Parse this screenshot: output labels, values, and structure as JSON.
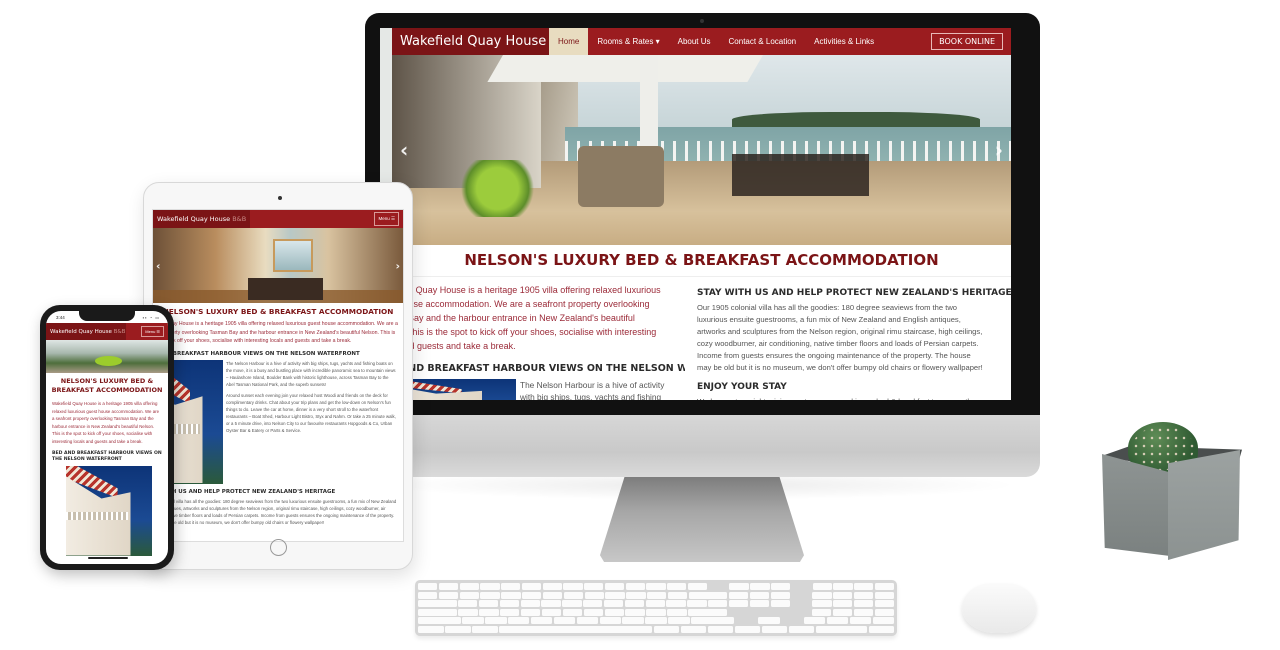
{
  "site": {
    "brand_name": "Wakefield Quay House",
    "brand_suffix": "B&B",
    "nav": [
      {
        "label": "Home",
        "active": true
      },
      {
        "label": "Rooms & Rates ▾",
        "active": false
      },
      {
        "label": "About Us",
        "active": false
      },
      {
        "label": "Contact & Location",
        "active": false
      },
      {
        "label": "Activities & Links",
        "active": false
      }
    ],
    "book_button": "BOOK ONLINE",
    "menu_button": "Menu ☰",
    "carousel_prev": "‹",
    "carousel_next": "›",
    "main_heading": "NELSON'S LUXURY BED & BREAKFAST ACCOMMODATION",
    "intro_lines": [
      "Wakefield Quay House is a heritage 1905 villa offering relaxed luxurious",
      "guest house accommodation. We are a seafront property overlooking",
      "Tasman Bay and the harbour entrance in New Zealand's beautiful",
      "Nelson. This is the spot to kick off your shoes, socialise with interesting",
      "locals and guests and take a break."
    ],
    "intro_full": "Wakefield Quay House is a heritage 1905 villa offering relaxed luxurious guest house accommodation. We are a seafront property overlooking Tasman Bay and the harbour entrance in New Zealand's beautiful Nelson. This is the spot to kick off your shoes, socialise with interesting locals and guests and take a break.",
    "harbour_heading": "BED AND BREAKFAST HARBOUR VIEWS ON THE NELSON WATERFRONT",
    "harbour_text": "The Nelson Harbour is a hive of activity with big ships, tugs, yachts and fishing boats on the move, it is a busy and bustling place with incredible panoramic sea to mountain views – Haulashore Island, Boulder Bank with historic lighthouse, across Tasman Bay to the Abel Tasman National Park, and the superb sunsets!",
    "sunset_text": "Around sunset each evening join your relaxed host Woodi and friends on the deck for complimentary drinks. Chat about your trip plans and get the low-down on Nelson's fun things to do. Leave the car at home, dinner is a very short stroll to the waterfront restaurants – Boat Shed, Harbour Light Bistro, Styx and Nahm. Or take a 25 minute walk, or a 5 minute drive, into Nelson City to our favourite restaurants Hopgoods & Co, Urban Oyster Bar & Eatery or Parts & Service.",
    "heritage_heading": "STAY WITH US AND HELP PROTECT NEW ZEALAND'S HERITAGE",
    "heritage_text": "Our 1905 colonial villa has all the goodies: 180 degree seaviews from the two luxurious ensuite guestrooms, a fun mix of New Zealand and English antiques, artworks and sculptures from the Nelson region, original rimu staircase, high ceilings, cozy woodburner, air conditioning, native timber floors and loads of Persian carpets. Income from guests ensures the ongoing maintenance of the property. The house may be old but it is no museum, we don't offer bumpy old chairs or flowery wallpaper!",
    "enjoy_heading": "ENJOY YOUR STAY",
    "enjoy_text": "We have a two night minimum stay year round in our bed & breakfast to ensure the best service and hospitality. Rates include complimentary happy hour, cooked breakfast and"
  },
  "phone": {
    "status_time": "3:44",
    "status_icons": "▪▪ ◔ ▭"
  },
  "colors": {
    "nav_red": "#9b1c1f",
    "brand_dark_red": "#7b1416",
    "active_tab": "#e8dcc0",
    "heading_red": "#7b1416",
    "intro_text": "#9b2a38"
  }
}
